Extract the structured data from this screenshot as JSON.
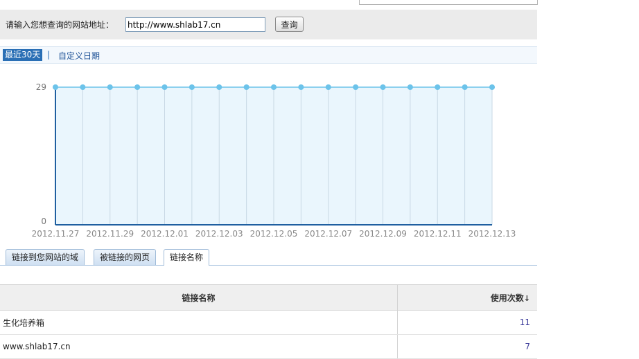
{
  "query": {
    "label": "请输入您想查询的网站地址：",
    "value": "http://www.shlab17.cn",
    "button": "查询"
  },
  "range": {
    "active": "最近30天",
    "separator": "|",
    "custom": "自定义日期"
  },
  "chart_data": {
    "type": "area",
    "x": [
      "2012.11.27",
      "2012.11.28",
      "2012.11.29",
      "2012.11.30",
      "2012.12.01",
      "2012.12.02",
      "2012.12.03",
      "2012.12.04",
      "2012.12.05",
      "2012.12.06",
      "2012.12.07",
      "2012.12.08",
      "2012.12.09",
      "2012.12.10",
      "2012.12.11",
      "2012.12.12",
      "2012.12.13"
    ],
    "tick_labels": [
      "2012.11.27",
      "2012.11.29",
      "2012.12.01",
      "2012.12.03",
      "2012.12.05",
      "2012.12.07",
      "2012.12.09",
      "2012.12.11",
      "2012.12.13"
    ],
    "values": [
      29,
      29,
      29,
      29,
      29,
      29,
      29,
      29,
      29,
      29,
      29,
      29,
      29,
      29,
      29,
      29,
      29
    ],
    "ylim": [
      0,
      29
    ],
    "y_ticks": [
      "29",
      "0"
    ],
    "colors": {
      "line": "#6cc3ea",
      "fill": "#eaf6fd",
      "axis": "#1f5fa0",
      "grid": "#c8d8e4"
    }
  },
  "tabs": [
    {
      "label": "链接到您网站的域"
    },
    {
      "label": "被链接的网页"
    },
    {
      "label": "链接名称"
    }
  ],
  "table": {
    "headers": {
      "name": "链接名称",
      "count": "使用次数",
      "sort_icon": "↓"
    },
    "rows": [
      {
        "name": "生化培养箱",
        "count": "11"
      },
      {
        "name": "www.shlab17.cn",
        "count": "7"
      }
    ]
  }
}
